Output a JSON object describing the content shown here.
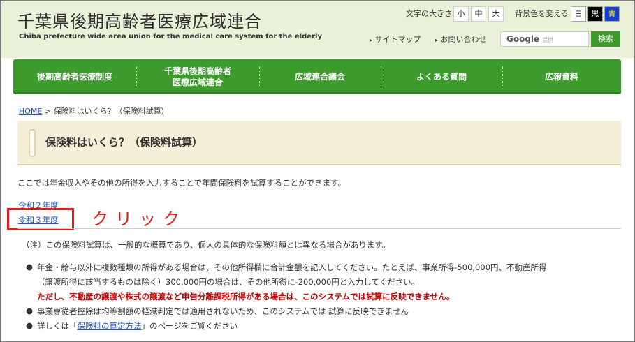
{
  "header": {
    "title": "千葉県後期高齢者医療広域連合",
    "subtitle": "Chiba prefecture wide area union for the medical care system for the elderly",
    "font_size_label": "文字の大きさ",
    "font_sizes": [
      "小",
      "中",
      "大"
    ],
    "bg_label": "背景色を変える",
    "bg_options": [
      "白",
      "黒",
      "青"
    ],
    "links": [
      "サイトマップ",
      "お問い合わせ"
    ],
    "search": {
      "placeholder_brand": "Google",
      "placeholder_sub": "提供",
      "button": "検索"
    }
  },
  "nav": [
    "後期高齢者医療制度",
    "千葉県後期高齢者\n医療広域連合",
    "広域連合議会",
    "よくある質問",
    "広報資料"
  ],
  "breadcrumb": {
    "home": "HOME",
    "current": " > 保険料はいくら？（保険料試算）"
  },
  "page": {
    "heading": "保険料はいくら？（保険料試算）",
    "intro": "ここでは年金収入やその他の所得を入力することで年間保険料を試算することができます。",
    "year_links": [
      "令和２年度",
      "令和３年度"
    ],
    "annotation": "クリック",
    "note": "（注）この保険料試算は、一般的な概算であり、個人の具体的な保険料額とは異なる場合があります。",
    "bullets": [
      {
        "line1": "年金・給与以外に複数種類の所得がある場合は、その他所得欄に合計金額を記入してください。たとえば、事業所得-500,000円、不動産所得",
        "line2": "（譲渡所得に該当するものは除く）300,000円の場合は、その他所得に-200,000円と入力してください。",
        "line3": "ただし、不動産の譲渡や株式の譲渡など申告分離課税所得がある場合は、このシステムでは試算に反映できません。"
      },
      {
        "line1": "事業専従者控除は均等割額の軽減判定では適用されないため、このシステムでは 試算に反映できません"
      },
      {
        "prefix": "詳しくは「",
        "link": "保険料の算定方法",
        "suffix": "」のページをご覧ください"
      }
    ]
  },
  "colors": {
    "accent_green": "#3c9b2c",
    "header_bg": "#e9f2d9",
    "heading_bg": "#f3efd9",
    "highlight_red": "#e61919",
    "link_blue": "#2255bb"
  }
}
